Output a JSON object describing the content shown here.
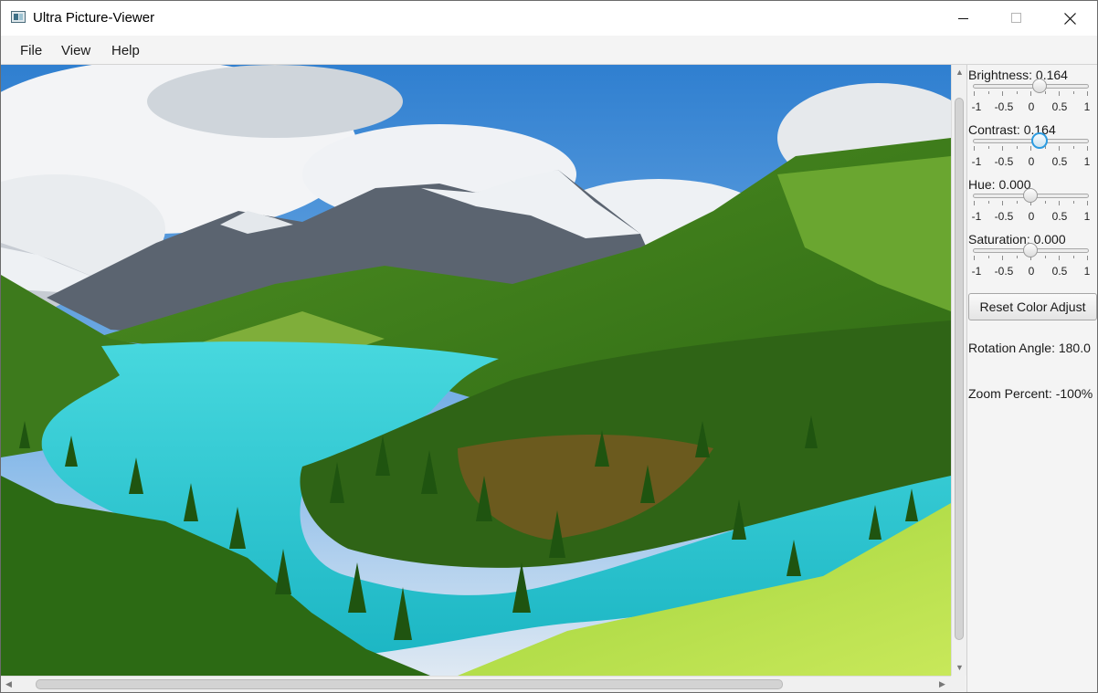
{
  "window": {
    "title": "Ultra Picture-Viewer"
  },
  "menu": {
    "items": [
      "File",
      "View",
      "Help"
    ]
  },
  "adjustments": {
    "sliders": [
      {
        "name": "brightness",
        "label": "Brightness: 0.164",
        "value": 0.164,
        "min": -1,
        "max": 1,
        "focused": false
      },
      {
        "name": "contrast",
        "label": "Contrast: 0.164",
        "value": 0.164,
        "min": -1,
        "max": 1,
        "focused": true
      },
      {
        "name": "hue",
        "label": "Hue: 0.000",
        "value": 0.0,
        "min": -1,
        "max": 1,
        "focused": false
      },
      {
        "name": "saturation",
        "label": "Saturation: 0.000",
        "value": 0.0,
        "min": -1,
        "max": 1,
        "focused": false
      }
    ],
    "tick_labels": [
      "-1",
      "-0.5",
      "0",
      "0.5",
      "1"
    ],
    "reset_label": "Reset Color Adjust"
  },
  "status": {
    "rotation": "Rotation Angle: 180.0",
    "zoom": "Zoom Percent: -100%"
  },
  "colors": {
    "accent": "#2b9be0",
    "sky": "#3f8fd6",
    "lake": "#2fd0d2",
    "forest": "#3d7a1c",
    "meadow": "#a8d63a"
  }
}
